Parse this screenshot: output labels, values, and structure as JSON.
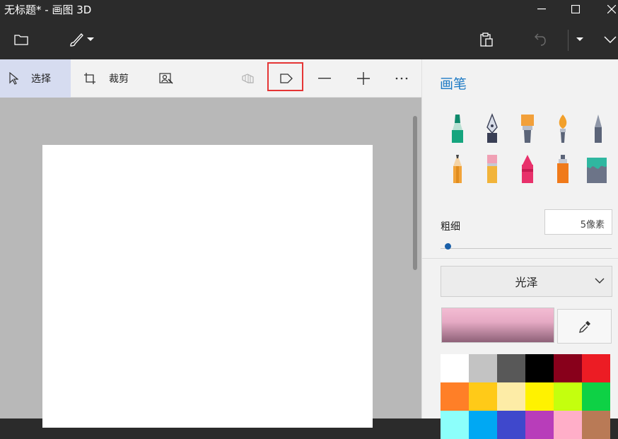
{
  "window": {
    "title": "无标题* - 画图 3D"
  },
  "toolbar": {
    "select_label": "选择",
    "crop_label": "裁剪"
  },
  "panel": {
    "title": "画笔",
    "brushes": [
      "marker-icon",
      "calligraphy-pen-icon",
      "oil-brush-icon",
      "watercolor-icon",
      "pixel-pen-icon",
      "pencil-icon",
      "eraser-icon",
      "crayon-icon",
      "spray-can-icon",
      "fill-bucket-icon"
    ],
    "thickness_label": "粗细",
    "thickness_value": "5像素",
    "thickness_slider": 0.04,
    "finish_label": "光泽",
    "swatch_colors": [
      "#ffffff",
      "#c3c3c3",
      "#585858",
      "#000000",
      "#88001b",
      "#ec1c24",
      "#ff7f27",
      "#ffca18",
      "#fdeca6",
      "#fff200",
      "#c4ff0e",
      "#0ed145",
      "#8cfffb",
      "#00a8f3",
      "#3f48cc",
      "#b83dba",
      "#ffaec8",
      "#b97a56"
    ]
  },
  "colors": {
    "accent": "#1f7bc5",
    "highlight": "#e53535"
  }
}
